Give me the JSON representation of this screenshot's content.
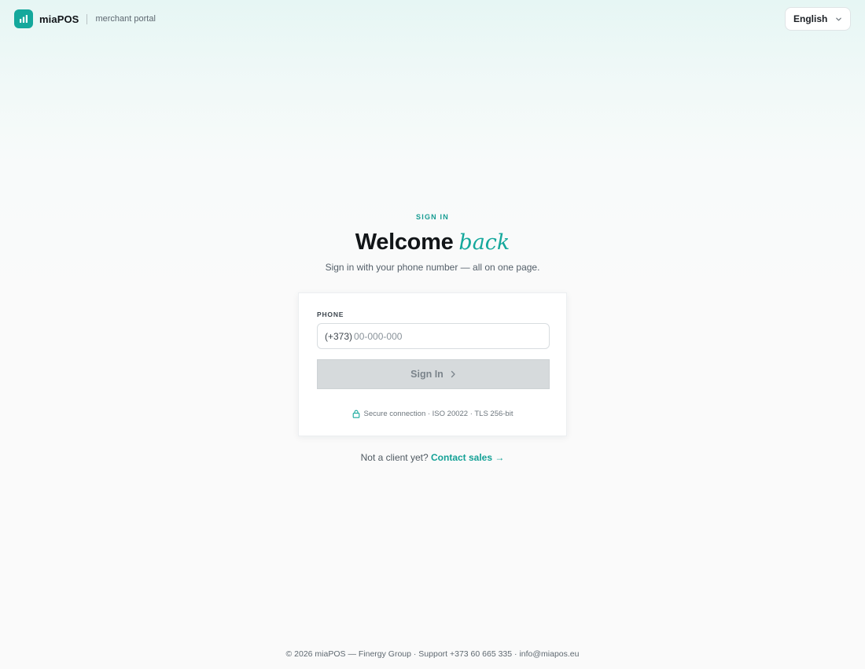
{
  "header": {
    "brand_name": "miaPOS",
    "brand_subtitle": "merchant portal",
    "language_selected": "English",
    "logo_icon": "bar-chart-icon",
    "brand_color": "#14a89c"
  },
  "login": {
    "eyebrow": "SIGN IN",
    "title_main": "Welcome",
    "title_accent": "back",
    "subtitle": "Sign in with your phone number — all on one page.",
    "phone_label": "PHONE",
    "phone_prefix": "(+373)",
    "phone_placeholder": "00-000-000",
    "signin_label": "Sign In",
    "signin_icon": "chevron-right-icon",
    "secure_icon": "lock-icon",
    "secure_text": "Secure connection · ISO 20022 · TLS 256-bit",
    "not_client_text": "Not a client yet?",
    "contact_sales_label": "Contact sales →"
  },
  "footer": {
    "text": "© 2026 miaPOS — Finergy Group · Support +373 60 665 335 · info@miapos.eu"
  }
}
